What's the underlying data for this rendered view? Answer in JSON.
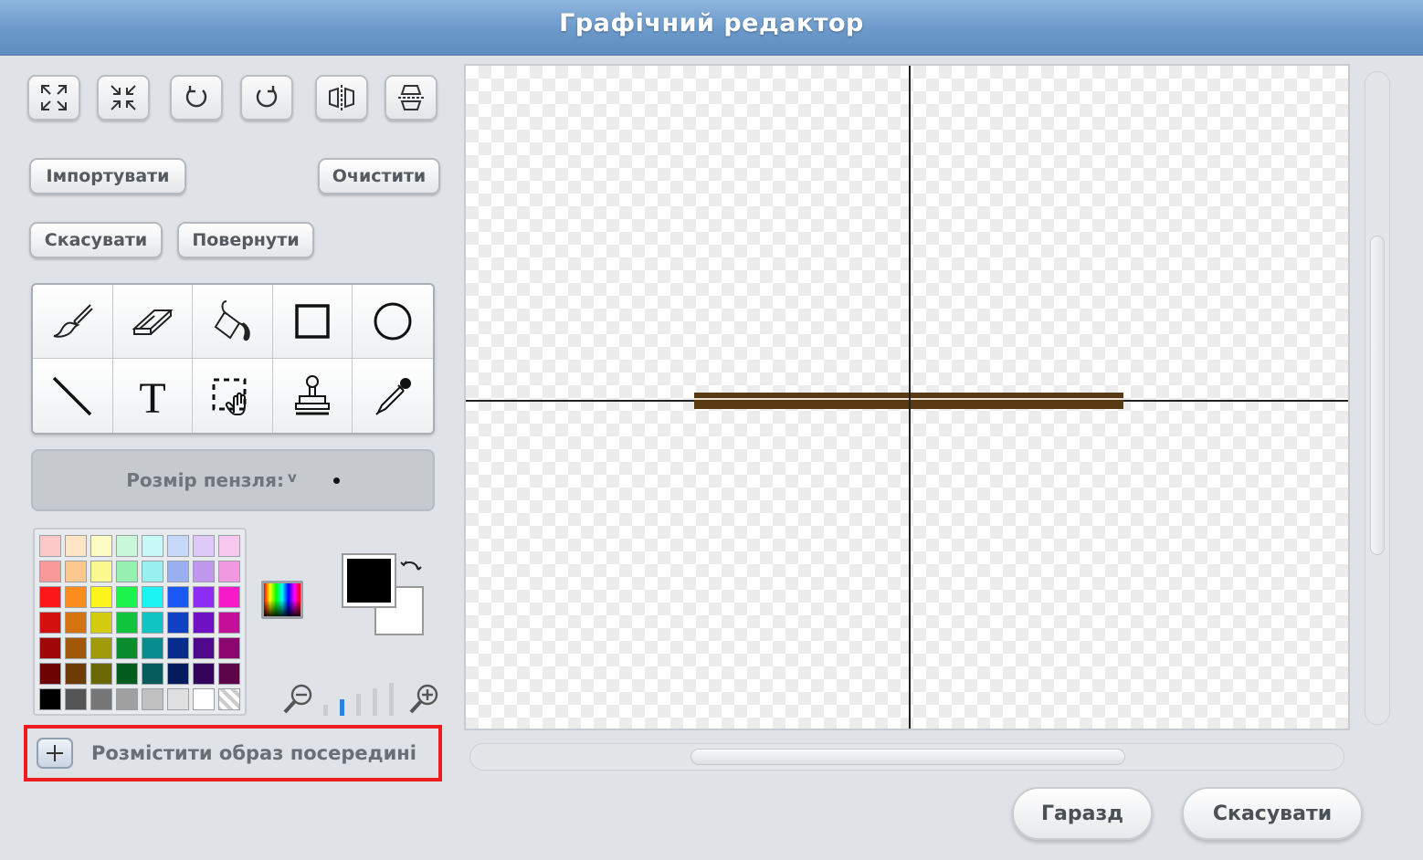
{
  "window": {
    "title": "Графічний редактор"
  },
  "transform_tools": [
    {
      "name": "grow-icon"
    },
    {
      "name": "shrink-icon"
    },
    {
      "name": "rotate-left-icon"
    },
    {
      "name": "rotate-right-icon"
    },
    {
      "name": "flip-horizontal-icon"
    },
    {
      "name": "flip-vertical-icon"
    }
  ],
  "actions": {
    "import_label": "Імпортувати",
    "clear_label": "Очистити",
    "undo_label": "Скасувати",
    "redo_label": "Повернути"
  },
  "drawing_tools": [
    {
      "name": "paintbrush-icon"
    },
    {
      "name": "eraser-icon"
    },
    {
      "name": "fill-bucket-icon"
    },
    {
      "name": "rectangle-icon"
    },
    {
      "name": "ellipse-icon"
    },
    {
      "name": "line-icon"
    },
    {
      "name": "text-icon",
      "glyph": "T"
    },
    {
      "name": "select-icon"
    },
    {
      "name": "stamp-icon"
    },
    {
      "name": "eyedropper-icon"
    }
  ],
  "brush": {
    "label": "Розмір пензля:",
    "chevron": "v"
  },
  "palette_colors": [
    "#fcc8c8",
    "#fde4c4",
    "#fdfcc4",
    "#c8f8d8",
    "#c8f8f8",
    "#c8d8f8",
    "#e0c8f8",
    "#f8c8f0",
    "#f89898",
    "#fcc890",
    "#fcf890",
    "#98f0b0",
    "#98f0f0",
    "#98b0f0",
    "#c098f0",
    "#f098e0",
    "#fc1818",
    "#fc8c1c",
    "#fcf41c",
    "#1cf44c",
    "#1cf4f4",
    "#1c58f4",
    "#8c2cf4",
    "#f41cc8",
    "#d41010",
    "#d47410",
    "#d4cc10",
    "#10c43c",
    "#10c4c4",
    "#1040c4",
    "#7010c4",
    "#c41098",
    "#a00808",
    "#a05808",
    "#a09c08",
    "#088c2c",
    "#088c8c",
    "#082c8c",
    "#50088c",
    "#8c0870",
    "#6c0404",
    "#6c3c04",
    "#6c6804",
    "#045c1c",
    "#045c5c",
    "#041c5c",
    "#34045c",
    "#5c0448",
    "#000000",
    "#555555",
    "#777777",
    "#a0a0a0",
    "#c0c0c0",
    "#e0e0e0",
    "#ffffff",
    "transparent"
  ],
  "colors": {
    "foreground": "#000000",
    "background": "#ffffff",
    "accent": "#ee1d1d",
    "shape_stroke": "#5a3a14"
  },
  "zoom": {
    "level_index": 1,
    "levels": 5
  },
  "center_option": {
    "label": "Розмістити образ посередині"
  },
  "dialog": {
    "ok_label": "Гаразд",
    "cancel_label": "Скасувати"
  }
}
